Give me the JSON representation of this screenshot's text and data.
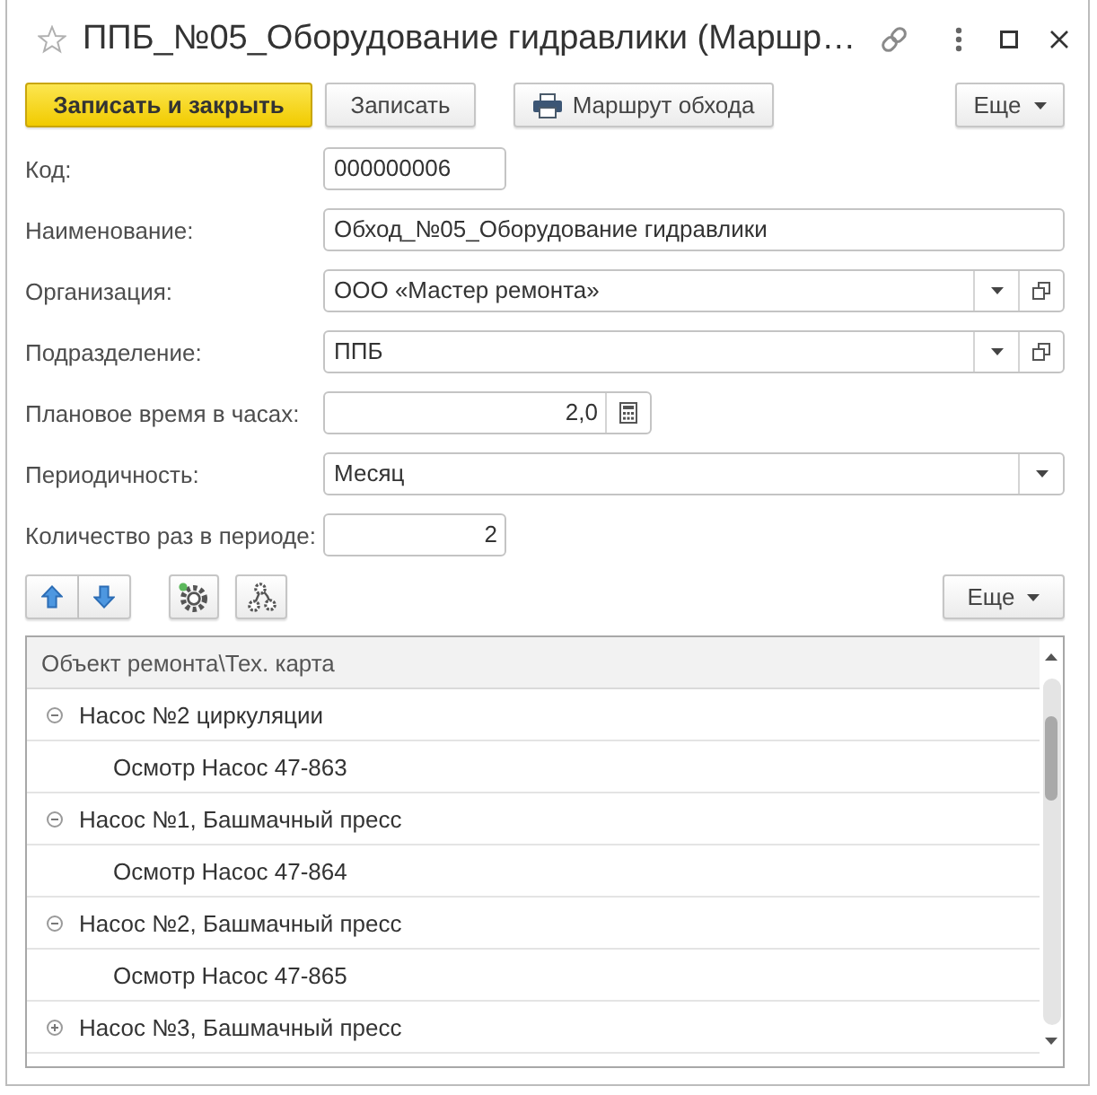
{
  "window": {
    "title": "ППБ_№05_Оборудование гидравлики (Маршр…"
  },
  "toolbar": {
    "buttons": [
      {
        "label": "Записать и закрыть",
        "kind": "primary"
      },
      {
        "label": "Записать",
        "kind": "plain"
      },
      {
        "label": "Маршрут обхода",
        "kind": "print"
      }
    ],
    "more": "Еще"
  },
  "fields": [
    {
      "label": "Код:",
      "value": "000000006",
      "kind": "code"
    },
    {
      "label": "Наименование:",
      "value": "Обход_№05_Оборудование гидравлики",
      "kind": "text"
    },
    {
      "label": "Организация:",
      "value": "ООО «Мастер ремонта»",
      "kind": "reference"
    },
    {
      "label": "Подразделение:",
      "value": "ППБ",
      "kind": "reference"
    },
    {
      "label": "Плановое время в часах:",
      "value": "2,0",
      "kind": "calc"
    },
    {
      "label": "Периодичность:",
      "value": "Месяц",
      "kind": "choice"
    },
    {
      "label": "Количество раз в периоде:",
      "value": "2",
      "kind": "count"
    }
  ],
  "table_toolbar": {
    "more": "Еще"
  },
  "table": {
    "header": "Объект ремонта\\Тех. карта",
    "rows": [
      {
        "label": "Насос №2 циркуляции",
        "expanded": true,
        "children": [
          {
            "label": "Осмотр Насос 47-863"
          }
        ]
      },
      {
        "label": "Насос №1, Башмачный пресс",
        "expanded": true,
        "children": [
          {
            "label": "Осмотр Насос 47-864"
          }
        ]
      },
      {
        "label": "Насос №2, Башмачный пресс",
        "expanded": true,
        "children": [
          {
            "label": "Осмотр Насос 47-865"
          }
        ]
      },
      {
        "label": "Насос №3, Башмачный пресс",
        "expanded": false
      }
    ]
  }
}
